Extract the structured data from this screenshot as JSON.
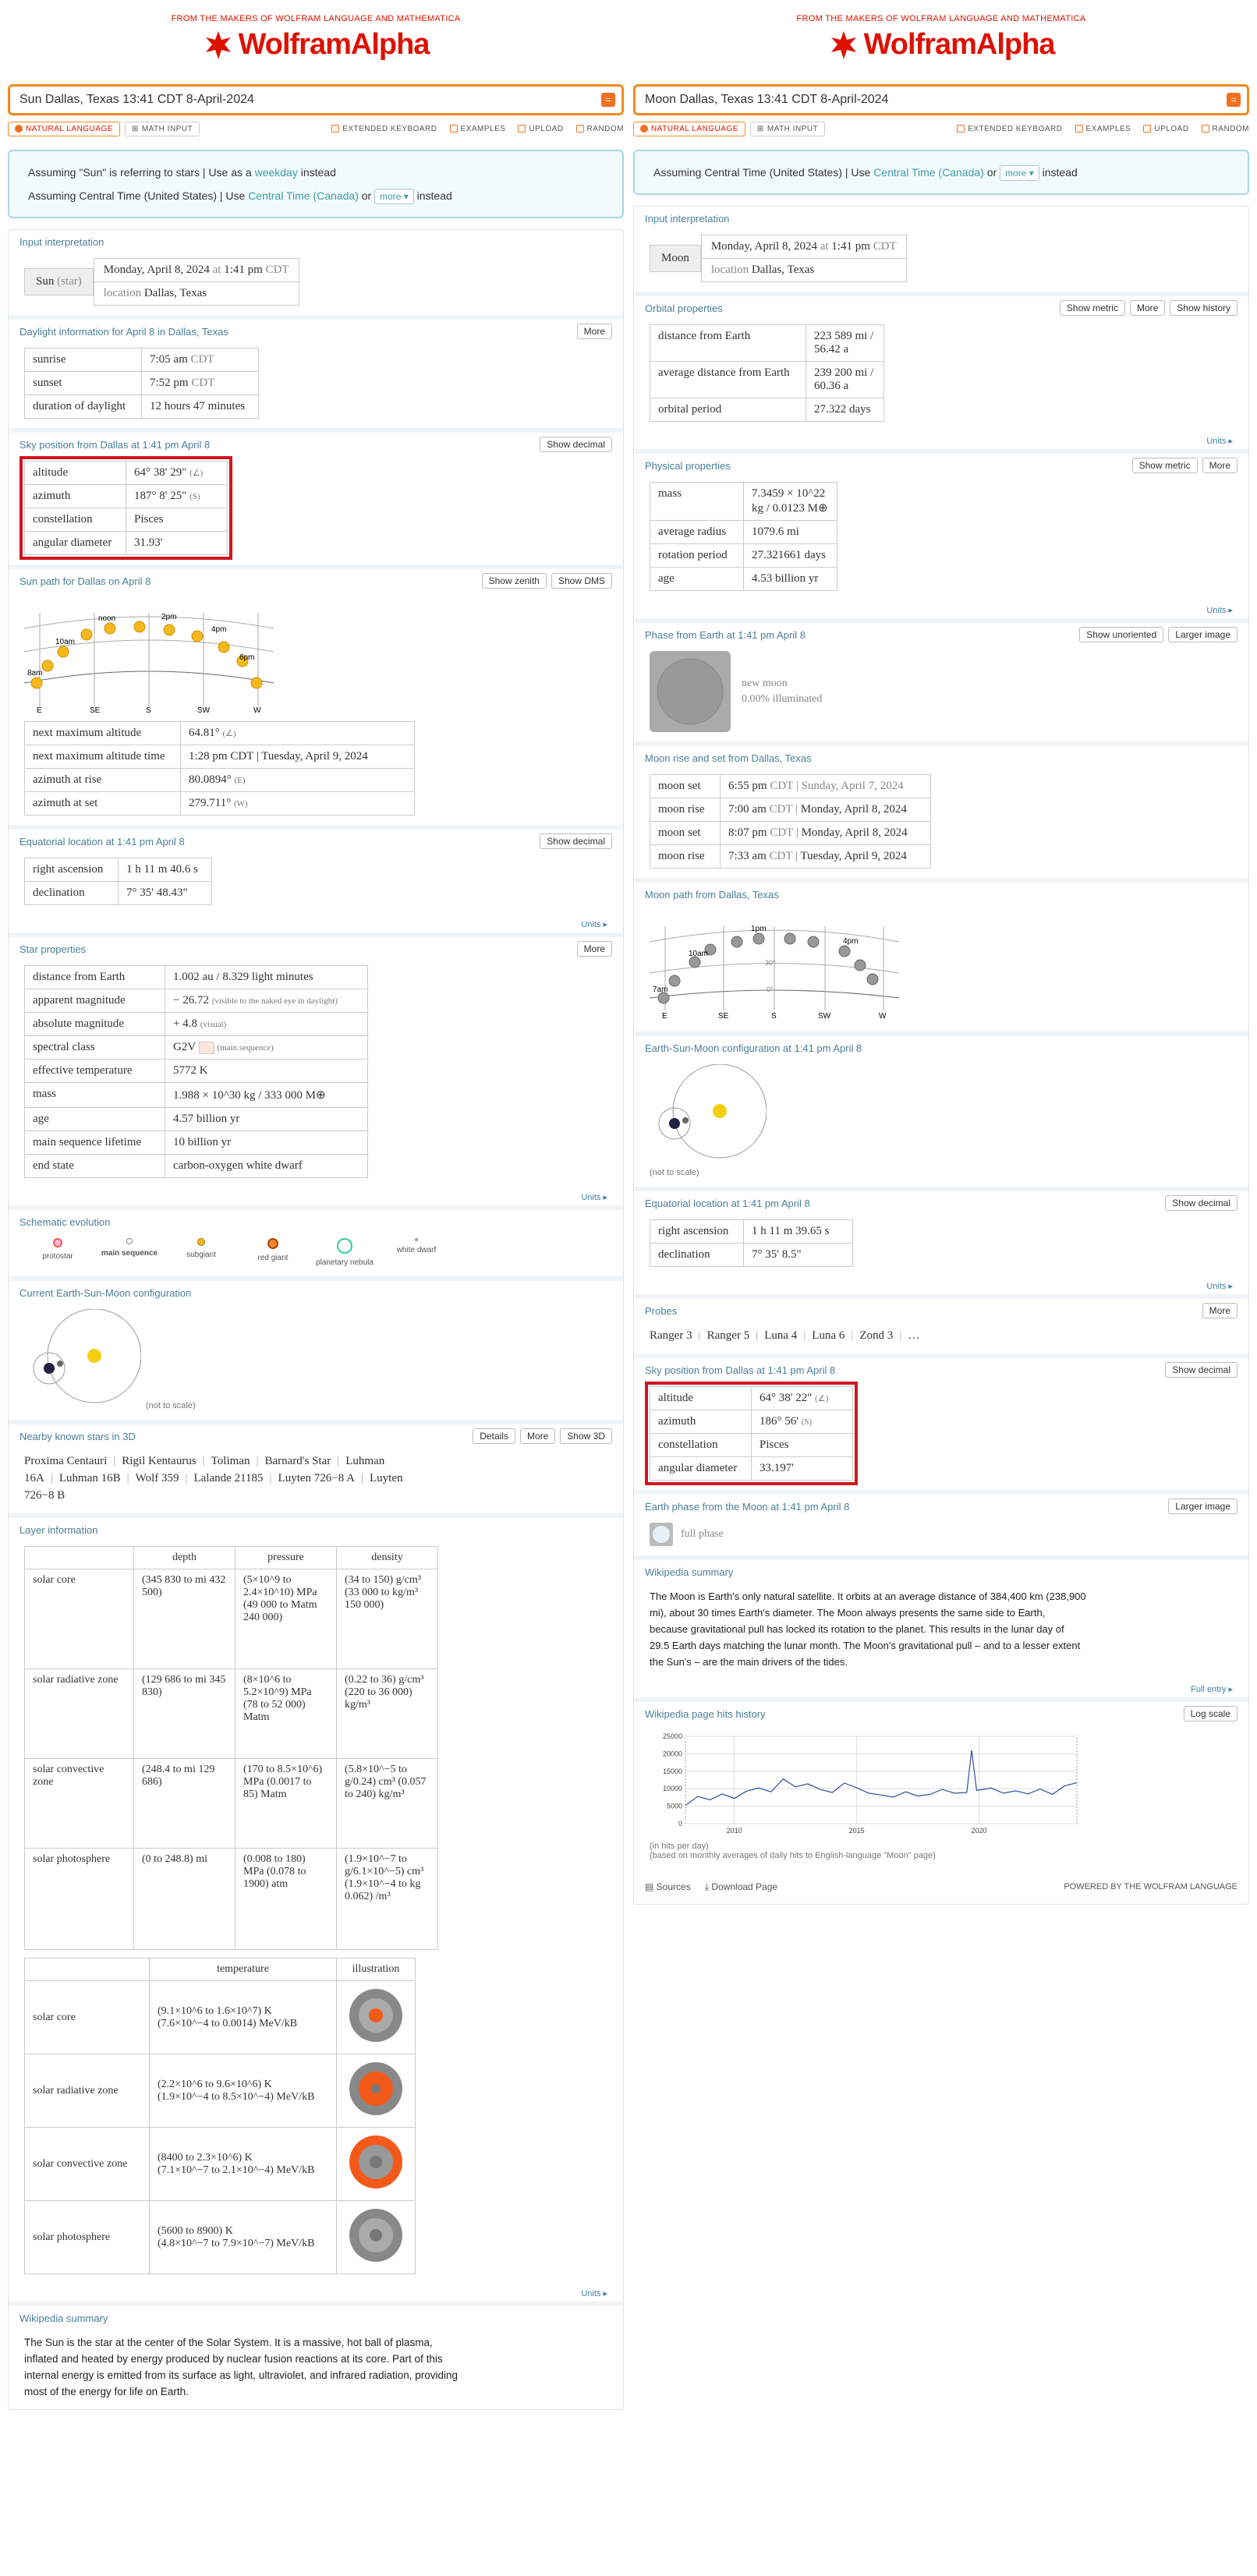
{
  "left": {
    "brand_makers": "FROM THE MAKERS OF WOLFRAM LANGUAGE AND MATHEMATICA",
    "brand_logo": "WolframAlpha",
    "query": "Sun Dallas, Texas 13:41 CDT 8-April-2024",
    "toolbar": {
      "natural": "NATURAL LANGUAGE",
      "math": "MATH INPUT",
      "keyboard": "EXTENDED KEYBOARD",
      "examples": "EXAMPLES",
      "upload": "UPLOAD",
      "random": "RANDOM"
    },
    "assume1_a": "Assuming \"Sun\" is referring to stars | Use as a ",
    "assume1_link": "weekday",
    "assume1_b": " instead",
    "assume2_a": "Assuming Central Time (United States) | Use ",
    "assume2_link": "Central Time (Canada)",
    "assume2_or": " or ",
    "assume2_more": "more ▾",
    "assume2_b": " instead",
    "input_title": "Input interpretation",
    "input_key": "Sun",
    "input_key_sub": "(star)",
    "input_date": "Monday, April 8, 2024",
    "input_at": " at ",
    "input_time": "1:41 pm",
    "input_tz": " CDT",
    "input_loc_label": "location",
    "input_loc": "Dallas, Texas",
    "daylight_title": "Daylight information for April 8 in Dallas, Texas",
    "daylight_btn": "More",
    "daylight": [
      [
        "sunrise",
        "7:05 am",
        "CDT"
      ],
      [
        "sunset",
        "7:52 pm",
        "CDT"
      ],
      [
        "duration of daylight",
        "12 hours  47 minutes",
        ""
      ]
    ],
    "sky_title": "Sky position from Dallas at 1:41 pm April 8",
    "sky_btn": "Show decimal",
    "sky": [
      [
        "altitude",
        "64°  38'  29\"",
        "(∠)"
      ],
      [
        "azimuth",
        "187°  8'  25\"",
        "(S)"
      ],
      [
        "constellation",
        "Pisces",
        ""
      ],
      [
        "angular diameter",
        "31.93'",
        ""
      ]
    ],
    "path_title": "Sun path for Dallas on April 8",
    "path_btn1": "Show zenith",
    "path_btn2": "Show DMS",
    "path_labels": {
      "noon": "noon",
      "t10": "10am",
      "t2": "2pm",
      "t4": "4pm",
      "t6": "6pm",
      "t8": "8am",
      "E": "E",
      "SE": "SE",
      "S": "S",
      "SW": "SW",
      "W": "W"
    },
    "path_table": [
      [
        "next maximum altitude",
        "64.81°",
        "(∠)"
      ],
      [
        "next maximum altitude time",
        "1:28 pm  CDT  |  Tuesday, April 9, 2024",
        ""
      ],
      [
        "azimuth at rise",
        "80.0894°",
        "(E)"
      ],
      [
        "azimuth at set",
        "279.711°",
        "(W)"
      ]
    ],
    "eq_title": "Equatorial location at 1:41 pm April 8",
    "eq_btn": "Show decimal",
    "eq": [
      [
        "right ascension",
        "1 h  11 m  40.6 s"
      ],
      [
        "declination",
        "7°  35'  48.43\""
      ]
    ],
    "units": "Units ▸",
    "star_title": "Star properties",
    "star_btn": "More",
    "star": [
      [
        "distance from Earth",
        "1.002 au / 8.329 light minutes"
      ],
      [
        "apparent magnitude",
        "− 26.72",
        "(visible to the naked eye in daylight)"
      ],
      [
        "absolute magnitude",
        "+ 4.8",
        "(visual)"
      ],
      [
        "spectral class",
        "G2V",
        "(main sequence)"
      ],
      [
        "effective temperature",
        "5772 K",
        ""
      ],
      [
        "mass",
        "1.988 × 10^30 kg / 333 000 M⊕",
        ""
      ],
      [
        "age",
        "4.57 billion yr",
        ""
      ],
      [
        "main sequence lifetime",
        "10 billion yr",
        ""
      ],
      [
        "end state",
        "carbon-oxygen white dwarf",
        ""
      ]
    ],
    "schem_title": "Schematic evolution",
    "schem": [
      "protostar",
      "main sequence",
      "subgiant",
      "red giant",
      "planetary nebula",
      "white dwarf"
    ],
    "esm_title": "Current Earth-Sun-Moon configuration",
    "not_to_scale": "(not to scale)",
    "nearby_title": "Nearby known stars in 3D",
    "nearby_btns": [
      "Details",
      "More",
      "Show 3D"
    ],
    "nearby": [
      "Proxima Centauri",
      "Rigil Kentaurus",
      "Toliman",
      "Barnard's Star",
      "Luhman 16A",
      "Luhman 16B",
      "Wolf 359",
      "Lalande 21185",
      "Luyten 726−8 A",
      "Luyten 726−8 B"
    ],
    "layer_title": "Layer information",
    "layer_head": [
      "depth",
      "pressure",
      "density"
    ],
    "layers": [
      [
        "solar core",
        "(345 830 to mi 432 500)",
        "(5×10^9 to 2.4×10^10) MPa (49 000 to Matm 240 000)",
        "(34 to 150) g/cm³ (33 000 to kg/m³ 150 000)"
      ],
      [
        "solar radiative zone",
        "(129 686 to mi 345 830)",
        "(8×10^6 to 5.2×10^9) MPa (78 to 52 000) Matm",
        "(0.22 to 36) g/cm³ (220 to 36 000) kg/m³"
      ],
      [
        "solar convective zone",
        "(248.4 to mi 129 686)",
        "(170 to 8.5×10^6) MPa (0.0017 to 85) Matm",
        "(5.8×10^−5 to g/0.24) cm³ (0.057 to 240) kg/m³"
      ],
      [
        "solar photosphere",
        "(0 to 248.8) mi",
        "(0.008 to 180) MPa (0.078 to 1900) atm",
        "(1.9×10^−7 to g/6.1×10^−5) cm³ (1.9×10^−4 to kg 0.062) /m³"
      ]
    ],
    "temp_head": [
      "temperature",
      "illustration"
    ],
    "temps": [
      [
        "solar core",
        "(9.1×10^6 to 1.6×10^7) K",
        "(7.6×10^−4 to 0.0014) MeV/kB"
      ],
      [
        "solar radiative zone",
        "(2.2×10^6 to 9.6×10^6) K",
        "(1.9×10^−4 to 8.5×10^−4) MeV/kB"
      ],
      [
        "solar convective zone",
        "(8400 to 2.3×10^6) K",
        "(7.1×10^−7 to 2.1×10^−4) MeV/kB"
      ],
      [
        "solar photosphere",
        "(5600 to 8900) K",
        "(4.8×10^−7 to 7.9×10^−7) MeV/kB"
      ]
    ],
    "wiki_title": "Wikipedia summary",
    "wiki": "The Sun is the star at the center of the Solar System. It is a massive, hot ball of plasma, inflated and heated by energy produced by nuclear fusion reactions at its core. Part of this internal energy is emitted from its surface as light, ultraviolet, and infrared radiation, providing most of the energy for life on Earth."
  },
  "right": {
    "brand_makers": "FROM THE MAKERS OF WOLFRAM LANGUAGE AND MATHEMATICA",
    "brand_logo": "WolframAlpha",
    "query": "Moon Dallas, Texas 13:41 CDT 8-April-2024",
    "assume_a": "Assuming Central Time (United States) | Use ",
    "assume_link": "Central Time (Canada)",
    "assume_or": " or ",
    "assume_more": "more ▾",
    "assume_b": " instead",
    "input_title": "Input interpretation",
    "input_key": "Moon",
    "input_date": "Monday, April 8, 2024",
    "input_at": " at ",
    "input_time": "1:41 pm",
    "input_tz": " CDT",
    "input_loc_label": "location",
    "input_loc": "Dallas, Texas",
    "orb_title": "Orbital properties",
    "orb_btns": [
      "Show metric",
      "More",
      "Show history"
    ],
    "orb": [
      [
        "distance from Earth",
        "223 589 mi / 56.42 a"
      ],
      [
        "average distance from Earth",
        "239 200 mi / 60.36 a"
      ],
      [
        "orbital period",
        "27.322 days"
      ]
    ],
    "phys_title": "Physical properties",
    "phys_btns": [
      "Show metric",
      "More"
    ],
    "phys": [
      [
        "mass",
        "7.3459 × 10^22 kg / 0.0123 M⊕"
      ],
      [
        "average radius",
        "1079.6 mi"
      ],
      [
        "rotation period",
        "27.321661 days"
      ],
      [
        "age",
        "4.53 billion yr"
      ]
    ],
    "phase_title": "Phase from Earth at 1:41 pm April 8",
    "phase_btns": [
      "Show unoriented",
      "Larger image"
    ],
    "phase_name": "new moon",
    "phase_pct": "0.00% illuminated",
    "rise_title": "Moon rise and set from Dallas, Texas",
    "rise": [
      [
        "moon set",
        "6:55 pm",
        "CDT",
        "Sunday, April 7, 2024"
      ],
      [
        "moon rise",
        "7:00 am",
        "CDT",
        "Monday, April 8, 2024"
      ],
      [
        "moon set",
        "8:07 pm",
        "CDT",
        "Monday, April 8, 2024"
      ],
      [
        "moon rise",
        "7:33 am",
        "CDT",
        "Tuesday, April 9, 2024"
      ]
    ],
    "mpath_title": "Moon path from Dallas, Texas",
    "mpath_labels": {
      "t1": "1pm",
      "t10": "10am",
      "t4": "4pm",
      "t7": "7am",
      "a30": "30°",
      "a0": "0°",
      "E": "E",
      "SE": "SE",
      "S": "S",
      "SW": "SW",
      "W": "W"
    },
    "esm_title": "Earth-Sun-Moon configuration at 1:41 pm April 8",
    "not_to_scale": "(not to scale)",
    "eq_title": "Equatorial location at 1:41 pm April 8",
    "eq_btn": "Show decimal",
    "eq": [
      [
        "right ascension",
        "1 h  11 m  39.65 s"
      ],
      [
        "declination",
        "7°  35'  8.5\""
      ]
    ],
    "units": "Units ▸",
    "probes_title": "Probes",
    "probes_btn": "More",
    "probes": [
      "Ranger 3",
      "Ranger 5",
      "Luna 4",
      "Luna 6",
      "Zond 3",
      "…"
    ],
    "sky_title": "Sky position from Dallas at 1:41 pm April 8",
    "sky_btn": "Show decimal",
    "sky": [
      [
        "altitude",
        "64°  38'  22\"",
        "(∠)"
      ],
      [
        "azimuth",
        "186°  56'",
        "(S)"
      ],
      [
        "constellation",
        "Pisces",
        ""
      ],
      [
        "angular diameter",
        "33.197'",
        ""
      ]
    ],
    "ephase_title": "Earth phase from the Moon at 1:41 pm April 8",
    "ephase_btn": "Larger image",
    "ephase": "full phase",
    "wiki_title": "Wikipedia summary",
    "wiki": "The Moon is Earth's only natural satellite. It orbits at an average distance of 384,400 km (238,900 mi), about 30 times Earth's diameter. The Moon always presents the same side to Earth, because gravitational pull has locked its rotation to the planet. This results in the lunar day of 29.5 Earth days matching the lunar month. The Moon's gravitational pull – and to a lesser extent the Sun's – are the main drivers of the tides.",
    "wiki_full": "Full entry ▸",
    "hits_title": "Wikipedia page hits history",
    "hits_btn": "Log scale",
    "hits_note1": "(in hits per day)",
    "hits_note2": "(based on monthly averages of daily hits to English-language \"Moon\" page)",
    "footer_sources": "Sources",
    "footer_download": "Download Page",
    "footer_powered": "POWERED BY THE WOLFRAM LANGUAGE",
    "chart_data": {
      "type": "line",
      "title": "",
      "xlabel": "",
      "ylabel": "",
      "x_ticks": [
        "2010",
        "2015",
        "2020"
      ],
      "y_ticks": [
        0,
        5000,
        10000,
        15000,
        20000,
        25000
      ],
      "ylim": [
        0,
        25000
      ],
      "xlim": [
        2008,
        2024
      ],
      "series": [
        {
          "values": [
            [
              2008,
              5200
            ],
            [
              2008.5,
              7800
            ],
            [
              2009,
              6800
            ],
            [
              2009.5,
              8500
            ],
            [
              2010,
              7200
            ],
            [
              2010.5,
              9300
            ],
            [
              2011,
              10200
            ],
            [
              2011.5,
              9100
            ],
            [
              2012,
              12800
            ],
            [
              2012.5,
              10500
            ],
            [
              2013,
              11400
            ],
            [
              2013.5,
              9800
            ],
            [
              2014,
              8900
            ],
            [
              2014.5,
              11600
            ],
            [
              2015,
              10300
            ],
            [
              2015.5,
              8700
            ],
            [
              2016,
              8200
            ],
            [
              2016.5,
              7600
            ],
            [
              2017,
              9100
            ],
            [
              2017.5,
              7900
            ],
            [
              2018,
              8400
            ],
            [
              2018.5,
              9800
            ],
            [
              2019,
              8700
            ],
            [
              2019.5,
              8900
            ],
            [
              2019.7,
              21000
            ],
            [
              2019.9,
              9500
            ],
            [
              2020.5,
              10200
            ],
            [
              2021,
              8700
            ],
            [
              2021.5,
              9400
            ],
            [
              2022,
              8500
            ],
            [
              2022.5,
              9900
            ],
            [
              2023,
              8400
            ],
            [
              2023.5,
              10800
            ],
            [
              2024,
              11700
            ]
          ]
        }
      ]
    }
  }
}
